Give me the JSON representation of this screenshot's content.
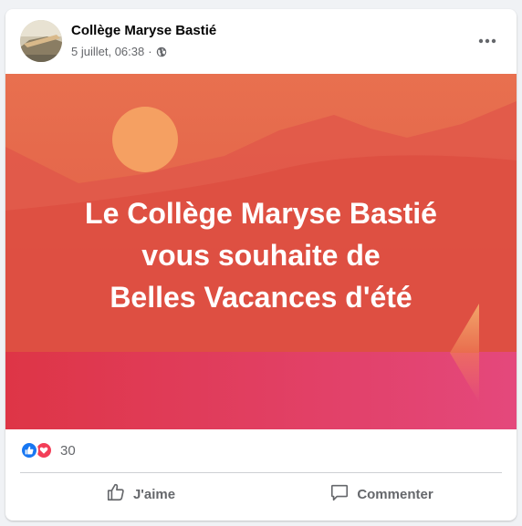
{
  "post": {
    "author": "Collège Maryse Bastié",
    "timestamp": "5 juillet, 06:38",
    "separator": "·",
    "audience_icon": "globe-icon",
    "more_icon": "more-options-icon"
  },
  "image": {
    "lines": [
      "Le Collège Maryse Bastié",
      "vous souhaite de",
      "Belles Vacances d'été"
    ],
    "colors": {
      "top": "#e8704f",
      "mid": "#dc4a3d",
      "bottom": "#e8457a",
      "sun": "#f5a062"
    }
  },
  "reactions": {
    "icons": [
      "like-icon",
      "love-icon"
    ],
    "count": "30"
  },
  "actions": {
    "like_label": "J'aime",
    "comment_label": "Commenter"
  },
  "colors": {
    "like_blue": "#1877f2",
    "love_red": "#f33e58",
    "secondary_text": "#65676b"
  }
}
